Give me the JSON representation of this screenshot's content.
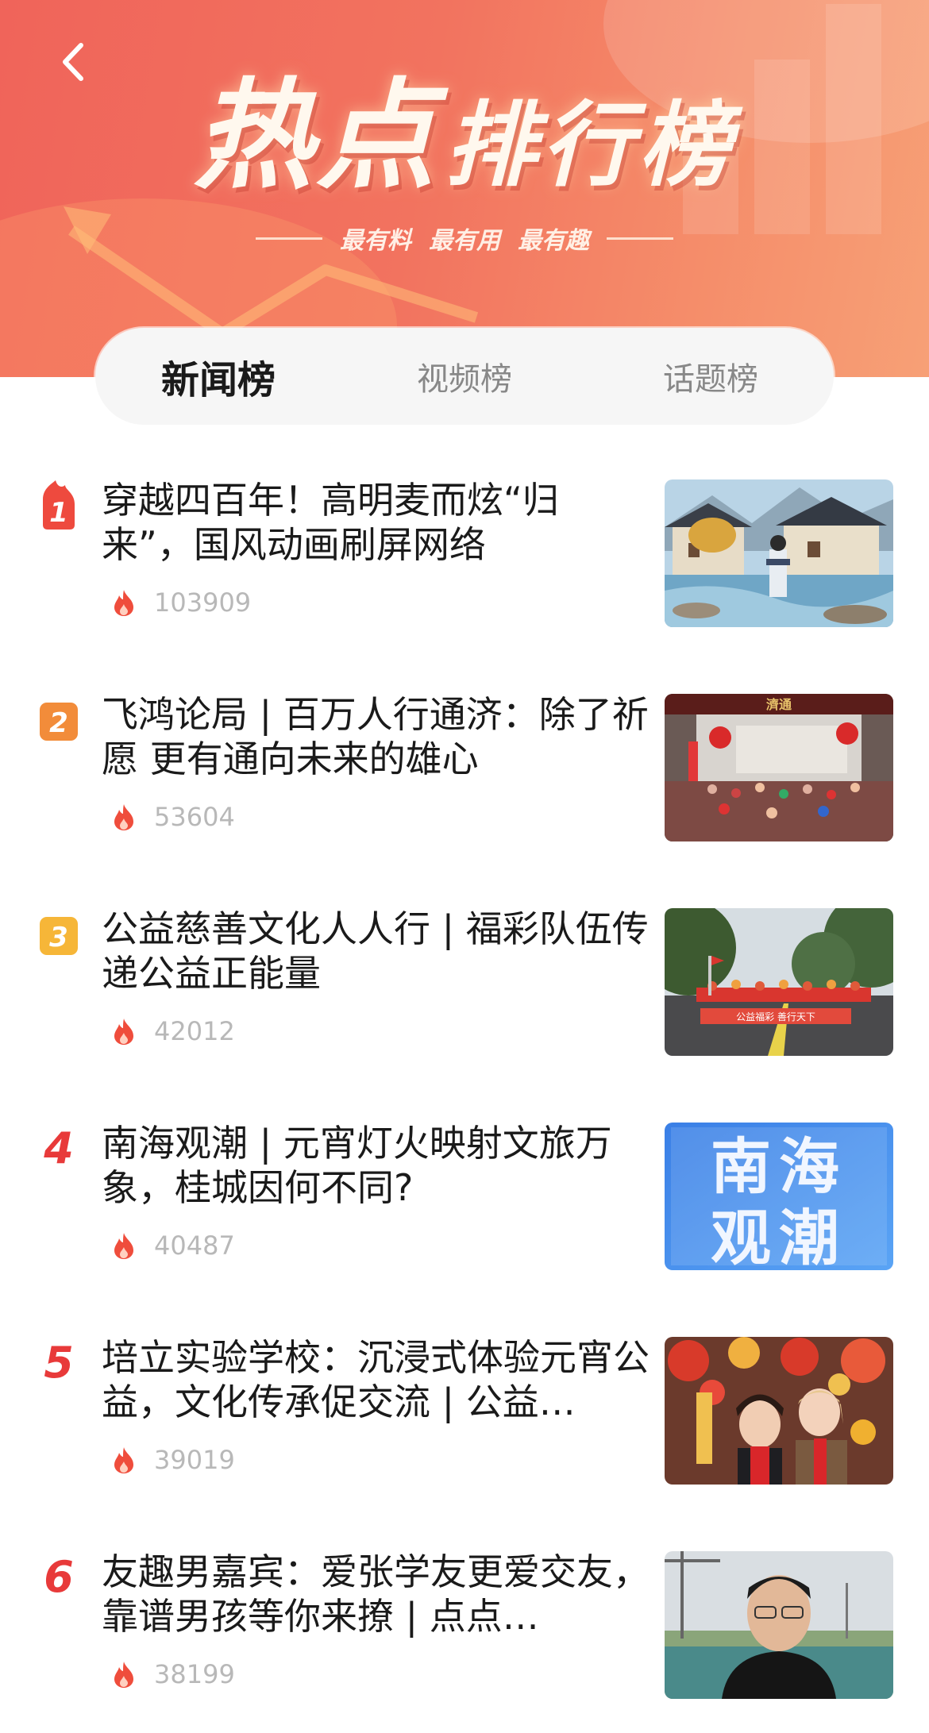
{
  "header": {
    "back_icon": "chevron-left-icon",
    "title_part1": "热点",
    "title_part2": "排行榜",
    "taglines": [
      "最有料",
      "最有用",
      "最有趣"
    ]
  },
  "tabs": [
    {
      "label": "新闻榜",
      "active": true
    },
    {
      "label": "视频榜",
      "active": false
    },
    {
      "label": "话题榜",
      "active": false
    }
  ],
  "colors": {
    "hero": "#f0645a",
    "rank1": "#ee4a3e",
    "rank2": "#f28c3a",
    "rank3": "#f6b638",
    "rank_text": "#e83a3a",
    "heat": "#ef4d3c"
  },
  "items": [
    {
      "rank": "1",
      "title": "穿越四百年！高明麦而炫“归来”，国风动画刷屏网络",
      "heat": "103909",
      "thumb_icon": "ancient-village-image"
    },
    {
      "rank": "2",
      "title": "飞鸿论局 | 百万人行通济：除了祈愿 更有通向未来的雄心",
      "heat": "53604",
      "thumb_icon": "crowd-gate-image",
      "thumb_text": "濟通"
    },
    {
      "rank": "3",
      "title": "公益慈善文化人人行 | 福彩队伍传递公益正能量",
      "heat": "42012",
      "thumb_icon": "parade-banner-image",
      "thumb_text": "公益福彩 善行天下"
    },
    {
      "rank": "4",
      "title": "南海观潮 | 元宵灯火映射文旅万象，桂城因何不同?",
      "heat": "40487",
      "thumb_icon": "title-card-image",
      "thumb_text": [
        "南海",
        "观潮"
      ]
    },
    {
      "rank": "5",
      "title": "培立实验学校：沉浸式体验元宵公益，文化传承促交流 | 公益…",
      "heat": "39019",
      "thumb_icon": "festival-people-image"
    },
    {
      "rank": "6",
      "title": "友趣男嘉宾：爱张学友更爱交友，靠谱男孩等你来撩 | 点点…",
      "heat": "38199",
      "thumb_icon": "portrait-image"
    }
  ]
}
